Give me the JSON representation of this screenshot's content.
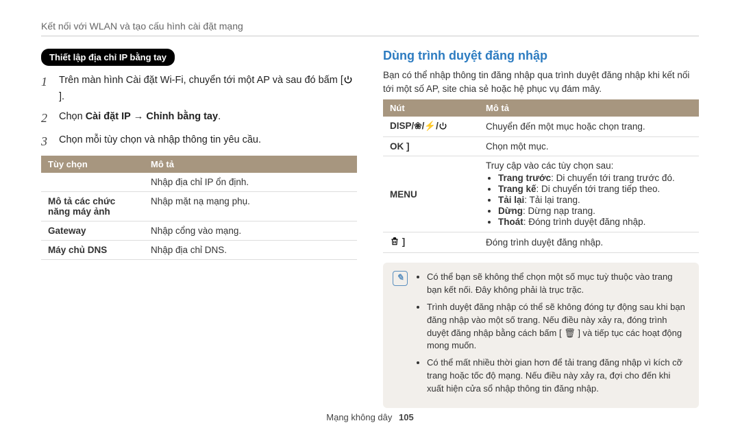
{
  "breadcrumb": "Kết nối với WLAN và tạo cấu hình cài đặt mạng",
  "left": {
    "pill": "Thiết lập địa chỉ IP bằng tay",
    "steps": [
      {
        "num": "1",
        "pre": "Trên màn hình Cài đặt Wi-Fi, chuyển tới một AP và sau đó bấm [",
        "post": "]."
      },
      {
        "num": "2",
        "pre": "Chọn ",
        "b1": "Cài đặt IP",
        "arrow": " → ",
        "b2": "Chỉnh bằng tay",
        "post": "."
      },
      {
        "num": "3",
        "text": "Chọn mỗi tùy chọn và nhập thông tin yêu cầu."
      }
    ],
    "table": {
      "h1": "Tùy chọn",
      "h2": "Mô tả",
      "rows": [
        {
          "c1": "",
          "c2": "Nhập địa chỉ IP ổn định."
        },
        {
          "c1": "Mô tả các chức năng máy ảnh",
          "c2": "Nhập mặt nạ mạng phụ."
        },
        {
          "c1": "Gateway",
          "c2": "Nhập cổng vào mạng."
        },
        {
          "c1": "Máy chủ DNS",
          "c2": "Nhập địa chỉ DNS."
        }
      ]
    }
  },
  "right": {
    "title": "Dùng trình duyệt đăng nhập",
    "intro": "Bạn có thể nhập thông tin đăng nhập qua trình duyệt đăng nhập khi kết nối tới một số AP, site chia sẻ hoặc hệ phục vụ đám mây.",
    "table": {
      "h1": "Nút",
      "h2": "Mô tả",
      "rows": {
        "r0": {
          "c1": "DISP/",
          "c1b": "/",
          "c1c": "/",
          "c2": "Chuyển đến một mục hoặc chọn trang."
        },
        "r1": {
          "c1": "OK ]",
          "c2": "Chọn một mục."
        },
        "r2": {
          "c1": "MENU",
          "lead": "Truy cập vào các tùy chọn sau:",
          "items": [
            {
              "b": "Trang trước",
              "t": ": Di chuyển tới trang trước đó."
            },
            {
              "b": "Trang kế",
              "t": ": Di chuyển tới trang tiếp theo."
            },
            {
              "b": "Tải lại",
              "t": ": Tải lại trang."
            },
            {
              "b": "Dừng",
              "t": ": Dừng nạp trang."
            },
            {
              "b": "Thoát",
              "t": ": Đóng trình duyệt đăng nhập."
            }
          ]
        },
        "r3": {
          "c1_suffix": " ]",
          "c2": "Đóng trình duyệt đăng nhập."
        }
      }
    },
    "notes": [
      "Có thể bạn sẽ không thể chọn một số mục tuỳ thuộc vào trang bạn kết nối. Đây không phải là trục trặc.",
      "Trình duyệt đăng nhập có thể sẽ không đóng tự động sau khi bạn đăng nhập vào một số trang. Nếu điều này xảy ra, đóng trình duyệt đăng nhập bằng cách bấm [ 🗑 ] và tiếp tục các hoạt động mong muốn.",
      "Có thể mất nhiều thời gian hơn để tải trang đăng nhập vì kích cỡ trang hoặc tốc độ mạng. Nếu điều này xảy ra, đợi cho đến khi xuất hiện cửa sổ nhập thông tin đăng nhập."
    ]
  },
  "footer": {
    "section": "Mạng không dây",
    "page": "105"
  }
}
